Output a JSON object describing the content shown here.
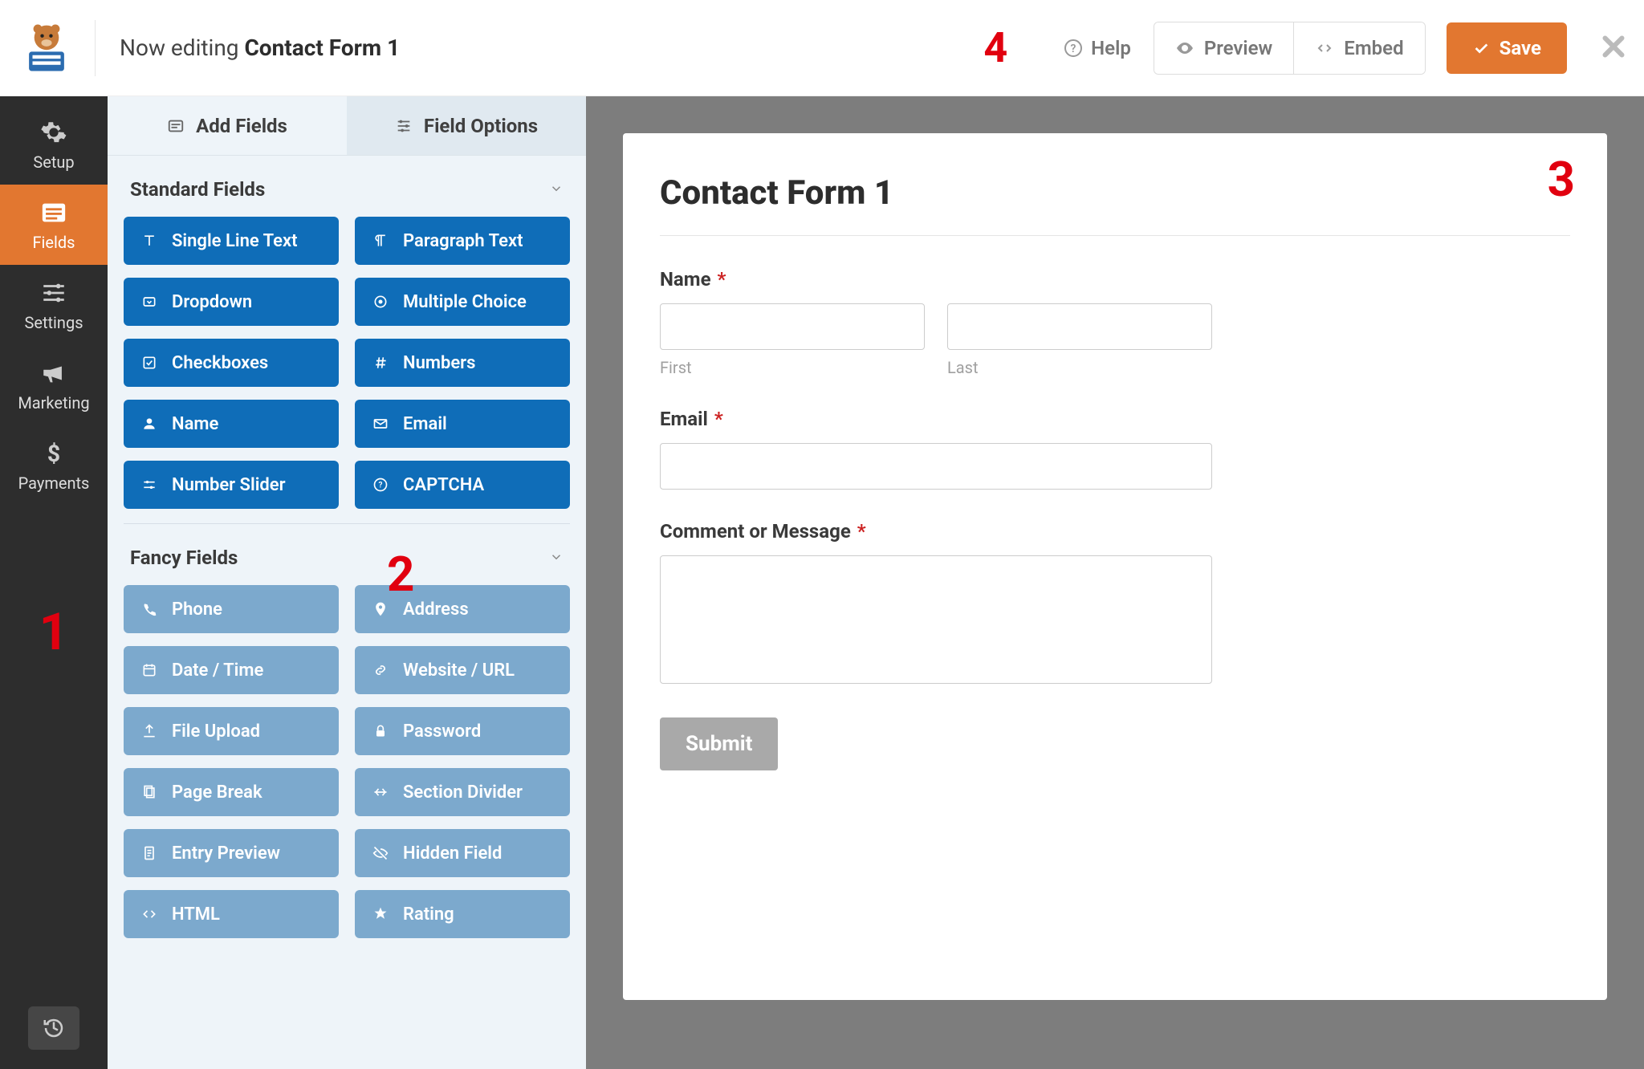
{
  "annotations": {
    "one": "1",
    "two": "2",
    "three": "3",
    "four": "4"
  },
  "topbar": {
    "editing_prefix": "Now editing ",
    "editing_title": "Contact Form 1",
    "help": "Help",
    "preview": "Preview",
    "embed": "Embed",
    "save": "Save"
  },
  "nav": {
    "setup": "Setup",
    "fields": "Fields",
    "settings": "Settings",
    "marketing": "Marketing",
    "payments": "Payments"
  },
  "panel": {
    "tab_add": "Add Fields",
    "tab_options": "Field Options",
    "section_standard": "Standard Fields",
    "section_fancy": "Fancy Fields",
    "standard": [
      "Single Line Text",
      "Paragraph Text",
      "Dropdown",
      "Multiple Choice",
      "Checkboxes",
      "Numbers",
      "Name",
      "Email",
      "Number Slider",
      "CAPTCHA"
    ],
    "fancy": [
      "Phone",
      "Address",
      "Date / Time",
      "Website / URL",
      "File Upload",
      "Password",
      "Page Break",
      "Section Divider",
      "Entry Preview",
      "Hidden Field",
      "HTML",
      "Rating"
    ]
  },
  "form": {
    "title": "Contact Form 1",
    "name_label": "Name",
    "first": "First",
    "last": "Last",
    "email_label": "Email",
    "comment_label": "Comment or Message",
    "submit": "Submit",
    "required": "*"
  }
}
